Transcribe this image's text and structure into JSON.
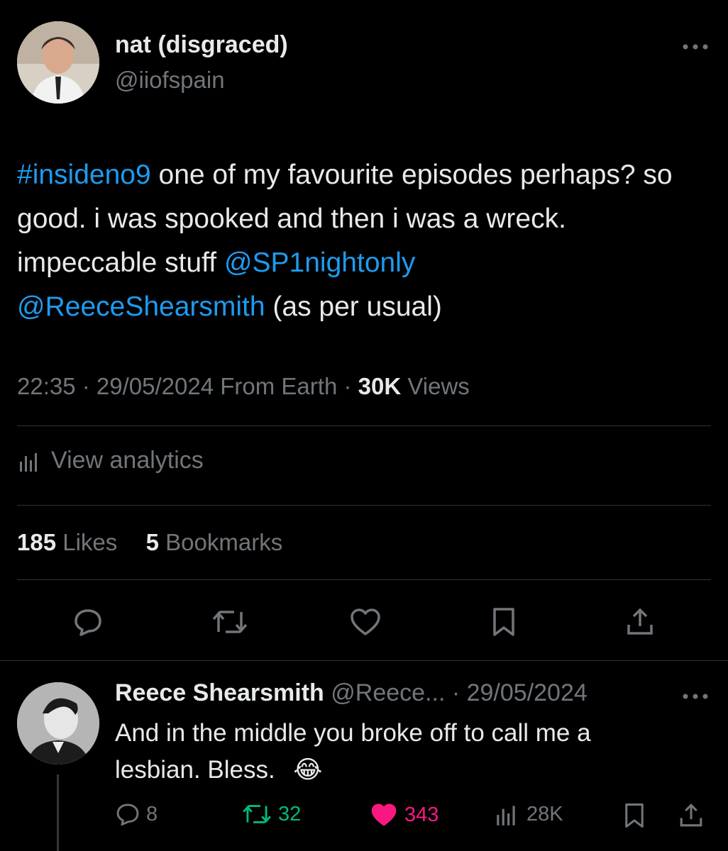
{
  "tweet": {
    "display_name": "nat (disgraced)",
    "handle": "@iiofspain",
    "body": {
      "hashtag": "#insideno9",
      "text1": " one of my favourite episodes perhaps? so good. i was spooked and then i was a wreck. impeccable stuff ",
      "mention1": "@SP1nightonly",
      "mention2": "@ReeceShearsmith",
      "text2": " (as per usual)"
    },
    "meta": {
      "time": "22:35",
      "sep1": " · ",
      "date": "29/05/2024",
      "source": " From Earth",
      "sep2": " · ",
      "views_count": "30K",
      "views_label": " Views"
    },
    "analytics_label": "View analytics",
    "stats": {
      "likes_count": "185",
      "likes_label": " Likes",
      "bookmarks_count": "5",
      "bookmarks_label": " Bookmarks"
    }
  },
  "reply": {
    "display_name": "Reece Shearsmith",
    "handle_date": " @Reece... · 29/05/2024",
    "text": "And in the middle you broke off to call me a lesbian.  Bless.",
    "emoji": "😂",
    "actions": {
      "replies": "8",
      "retweets": "32",
      "likes": "343",
      "views": "28K"
    }
  },
  "colors": {
    "background": "#000000",
    "text": "#e7e9ea",
    "muted": "#71767b",
    "link": "#1d9bf0",
    "retweet_green": "#00ba7c",
    "like_pink": "#f91880",
    "divider": "#2f3336"
  },
  "icons": [
    "more-icon",
    "analytics-icon",
    "reply-icon",
    "retweet-icon",
    "like-icon",
    "bookmark-icon",
    "share-icon",
    "views-icon"
  ]
}
